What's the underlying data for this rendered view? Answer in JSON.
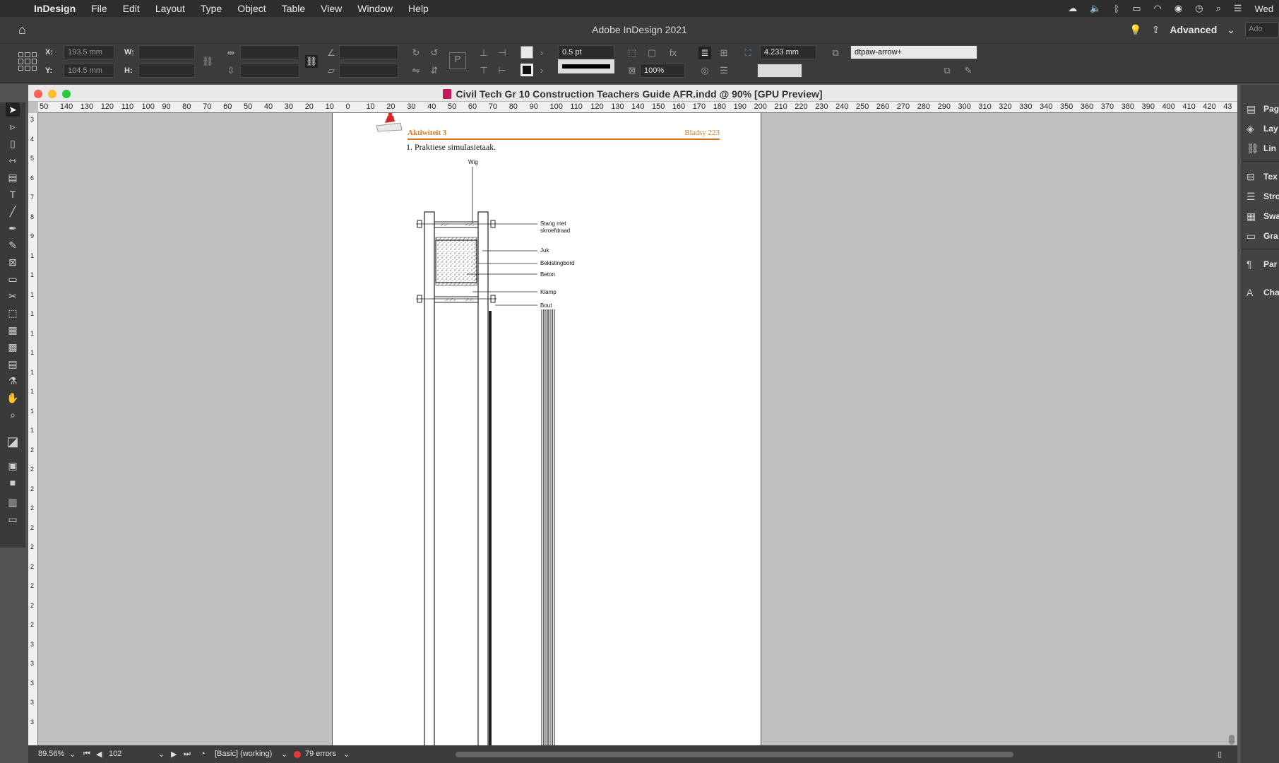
{
  "menubar": {
    "apple_icon": "apple-icon",
    "app_name": "InDesign",
    "items": [
      "File",
      "Edit",
      "Layout",
      "Type",
      "Object",
      "Table",
      "View",
      "Window",
      "Help"
    ],
    "clock": "Wed"
  },
  "appbar": {
    "title": "Adobe InDesign 2021",
    "workspace": "Advanced",
    "search_placeholder": "Ado"
  },
  "control": {
    "x_label": "X:",
    "x_value": "193.5 mm",
    "y_label": "Y:",
    "y_value": "104.5 mm",
    "w_label": "W:",
    "h_label": "H:",
    "stroke_weight": "0.5 pt",
    "opacity": "100%",
    "spacing": "4.233 mm",
    "object_style": "dtpaw-arrow+"
  },
  "document": {
    "title": "Civil Tech Gr 10 Construction Teachers Guide AFR.indd @ 90% [GPU Preview]",
    "ruler_h": [
      "50",
      "140",
      "130",
      "120",
      "110",
      "100",
      "90",
      "80",
      "70",
      "60",
      "50",
      "40",
      "30",
      "20",
      "10",
      "0",
      "10",
      "20",
      "30",
      "40",
      "50",
      "60",
      "70",
      "80",
      "90",
      "100",
      "110",
      "120",
      "130",
      "140",
      "150",
      "160",
      "170",
      "180",
      "190",
      "200",
      "210",
      "220",
      "230",
      "240",
      "250",
      "260",
      "270",
      "280",
      "290",
      "300",
      "310",
      "320",
      "330",
      "340",
      "350",
      "360",
      "370",
      "380",
      "390",
      "400",
      "410",
      "420",
      "43"
    ],
    "ruler_v": [
      "3",
      "4",
      "5",
      "6",
      "7",
      "8",
      "9",
      "1",
      "1",
      "1",
      "1",
      "1",
      "1",
      "1",
      "1",
      "1",
      "1",
      "2",
      "2",
      "2",
      "2",
      "2",
      "2",
      "2",
      "2",
      "2",
      "2",
      "3",
      "3",
      "3",
      "3",
      "3"
    ]
  },
  "page": {
    "header_left": "Aktiwiteit 3",
    "header_right": "Bladsy 223",
    "question": "1.  Praktiese simulasietaak.",
    "labels": {
      "wig": "Wig",
      "stang1": "Stang met",
      "stang2": "skroefdraad",
      "juk": "Juk",
      "bekisting": "Bekistingbord",
      "beton": "Beton",
      "klamp": "Klamp",
      "bout": "Bout"
    }
  },
  "status": {
    "zoom": "89.56%",
    "page_number": "102",
    "preflight_profile": "[Basic] (working)",
    "errors": "79 errors"
  },
  "panels": [
    {
      "icon": "pages-icon",
      "label": "Pag"
    },
    {
      "icon": "layers-icon",
      "label": "Lay"
    },
    {
      "icon": "links-icon",
      "label": "Lin"
    },
    {
      "icon": "text-wrap-icon",
      "label": "Tex"
    },
    {
      "icon": "stroke-icon",
      "label": "Stro"
    },
    {
      "icon": "swatches-icon",
      "label": "Swa"
    },
    {
      "icon": "gradient-icon",
      "label": "Gra"
    },
    {
      "icon": "paragraph-styles-icon",
      "label": "Par"
    },
    {
      "icon": "character-styles-icon",
      "label": "Cha"
    }
  ],
  "colors": {
    "accent_orange": "#d9781f",
    "error_red": "#e53935"
  }
}
